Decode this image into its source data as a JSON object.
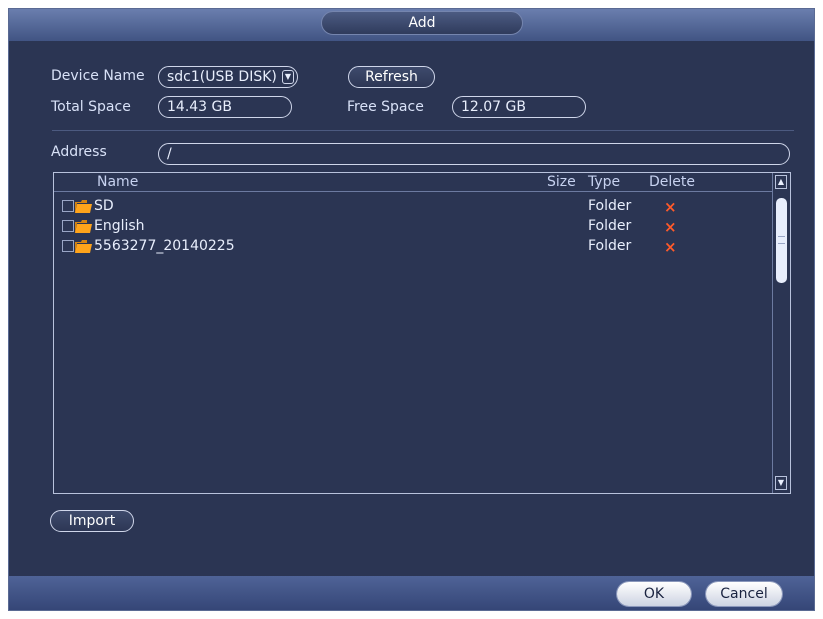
{
  "dialog": {
    "title": "Add"
  },
  "device": {
    "name_label": "Device Name",
    "name_value": "sdc1(USB DISK)",
    "refresh_label": "Refresh",
    "total_label": "Total Space",
    "total_value": "14.43 GB",
    "free_label": "Free Space",
    "free_value": "12.07 GB"
  },
  "address": {
    "label": "Address",
    "value": "/"
  },
  "list": {
    "columns": {
      "name": "Name",
      "size": "Size",
      "type": "Type",
      "delete": "Delete"
    },
    "rows": [
      {
        "name": "SD",
        "size": "",
        "type": "Folder",
        "delete": "×"
      },
      {
        "name": "English",
        "size": "",
        "type": "Folder",
        "delete": "×"
      },
      {
        "name": "5563277_20140225",
        "size": "",
        "type": "Folder",
        "delete": "×"
      }
    ]
  },
  "actions": {
    "import": "Import",
    "ok": "OK",
    "cancel": "Cancel"
  },
  "colors": {
    "background": "#2b3553",
    "delete": "#ff5a2a",
    "folder": "#ffa41b"
  },
  "icons": {
    "folder": "folder-icon",
    "delete": "delete-x-icon",
    "dropdown": "chevron-down-icon"
  }
}
